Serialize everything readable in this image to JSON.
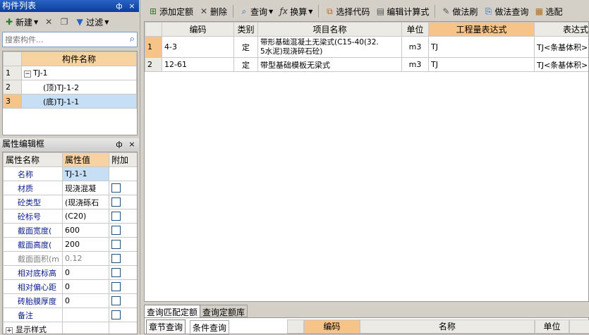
{
  "left_panel": {
    "title": "构件列表",
    "pin": "ф",
    "close": "×",
    "toolbar": {
      "new_label": "新建",
      "filter_label": "过滤"
    },
    "search": {
      "placeholder": "搜索构件..."
    },
    "tree": {
      "header": "构件名称",
      "rows": [
        {
          "num": "1",
          "label": "TJ-1"
        },
        {
          "num": "2",
          "label": "(顶)TJ-1-2"
        },
        {
          "num": "3",
          "label": "(底)TJ-1-1"
        }
      ]
    }
  },
  "props_panel": {
    "title": "属性编辑框",
    "pin": "ф",
    "close": "×",
    "headers": [
      "属性名称",
      "属性值",
      "附加"
    ],
    "rows": [
      {
        "name": "名称",
        "value": "TJ-1-1"
      },
      {
        "name": "材质",
        "value": "现浇混凝"
      },
      {
        "name": "砼类型",
        "value": "(现浇砾石"
      },
      {
        "name": "砼标号",
        "value": "(C20)"
      },
      {
        "name": "截面宽度(",
        "value": "600"
      },
      {
        "name": "截面高度(",
        "value": "200"
      },
      {
        "name": "截面面积(m",
        "value": "0.12"
      },
      {
        "name": "相对底标高",
        "value": "0"
      },
      {
        "name": "相对偏心距",
        "value": "0"
      },
      {
        "name": "砖胎膜厚度",
        "value": "0"
      },
      {
        "name": "备注",
        "value": ""
      },
      {
        "name": "显示样式",
        "value": ""
      }
    ]
  },
  "main_toolbar": {
    "add_quota": "添加定额",
    "delete": "删除",
    "query": "查询",
    "convert": "换算",
    "select_code": "选择代码",
    "edit_formula": "编辑计算式",
    "method_brush": "做法刷",
    "method_query": "做法查询",
    "select": "选配"
  },
  "quota_table": {
    "headers": [
      "编码",
      "类别",
      "项目名称",
      "单位",
      "工程量表达式",
      "表达式"
    ],
    "rows": [
      {
        "num": "1",
        "code": "4-3",
        "type": "定",
        "name_line1": "带形基础混凝土无梁式(C15-40(32.",
        "name_line2": "5水泥)现浇碎石砼)",
        "unit": "m3",
        "expr": "TJ",
        "expr2": "TJ<条基体积>"
      },
      {
        "num": "2",
        "code": "12-61",
        "type": "定",
        "name_line1": "带型基础模板无梁式",
        "name_line2": "",
        "unit": "m3",
        "expr": "TJ",
        "expr2": "TJ<条基体积>"
      }
    ]
  },
  "bottom": {
    "tabs": [
      "查询匹配定额",
      "查询定额库"
    ],
    "subtabs": [
      "章节查询",
      "条件查询"
    ],
    "headers": [
      "编码",
      "名称",
      "单位"
    ]
  }
}
